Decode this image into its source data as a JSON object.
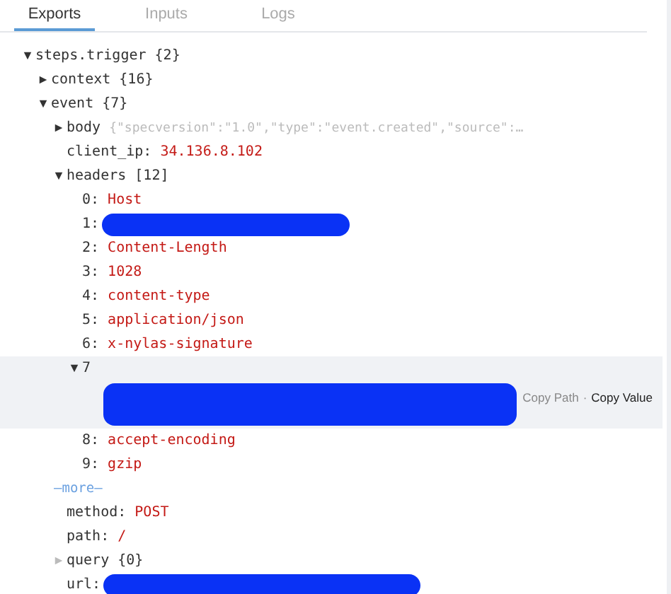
{
  "tabs": [
    {
      "label": "Exports",
      "selected": true
    },
    {
      "label": "Inputs",
      "selected": false
    },
    {
      "label": "Logs",
      "selected": false
    }
  ],
  "tree": [
    {
      "key": "steps.trigger",
      "summary": "{2}",
      "expanded": true,
      "children": [
        {
          "key": "context",
          "summary": "{16}",
          "expanded": false,
          "disabled": false
        },
        {
          "key": "event",
          "summary": "{7}",
          "expanded": true,
          "children": [
            {
              "key": "body",
              "preview": "{\"specversion\":\"1.0\",\"type\":\"event.created\",\"source\":…",
              "expanded": false,
              "disabled": false
            },
            {
              "key": "client_ip:",
              "value": "34.136.8.102"
            },
            {
              "key": "headers",
              "summary": "[12]",
              "expanded": true,
              "children": [
                {
                  "key": "0:",
                  "value": "Host"
                },
                {
                  "key": "1:",
                  "redacted": true
                },
                {
                  "key": "2:",
                  "value": "Content-Length"
                },
                {
                  "key": "3:",
                  "value": "1028"
                },
                {
                  "key": "4:",
                  "value": "content-type"
                },
                {
                  "key": "5:",
                  "value": "application/json"
                },
                {
                  "key": "6:",
                  "value": "x-nylas-signature"
                },
                {
                  "key": "7",
                  "expanded": true,
                  "actions": [
                    "Copy Path",
                    "Copy Value"
                  ],
                  "separator": "·",
                  "children": [
                    {
                      "redacted": true
                    }
                  ]
                },
                {
                  "key": "8:",
                  "value": "accept-encoding"
                },
                {
                  "key": "9:",
                  "value": "gzip"
                },
                {
                  "kind": "more",
                  "label": "—more—"
                }
              ]
            },
            {
              "key": "method:",
              "value": "POST"
            },
            {
              "key": "path:",
              "value": "/"
            },
            {
              "key": "query",
              "summary": "{0}",
              "expanded": false,
              "disabled": true
            },
            {
              "key": "url:",
              "redacted": true
            }
          ]
        }
      ]
    }
  ]
}
